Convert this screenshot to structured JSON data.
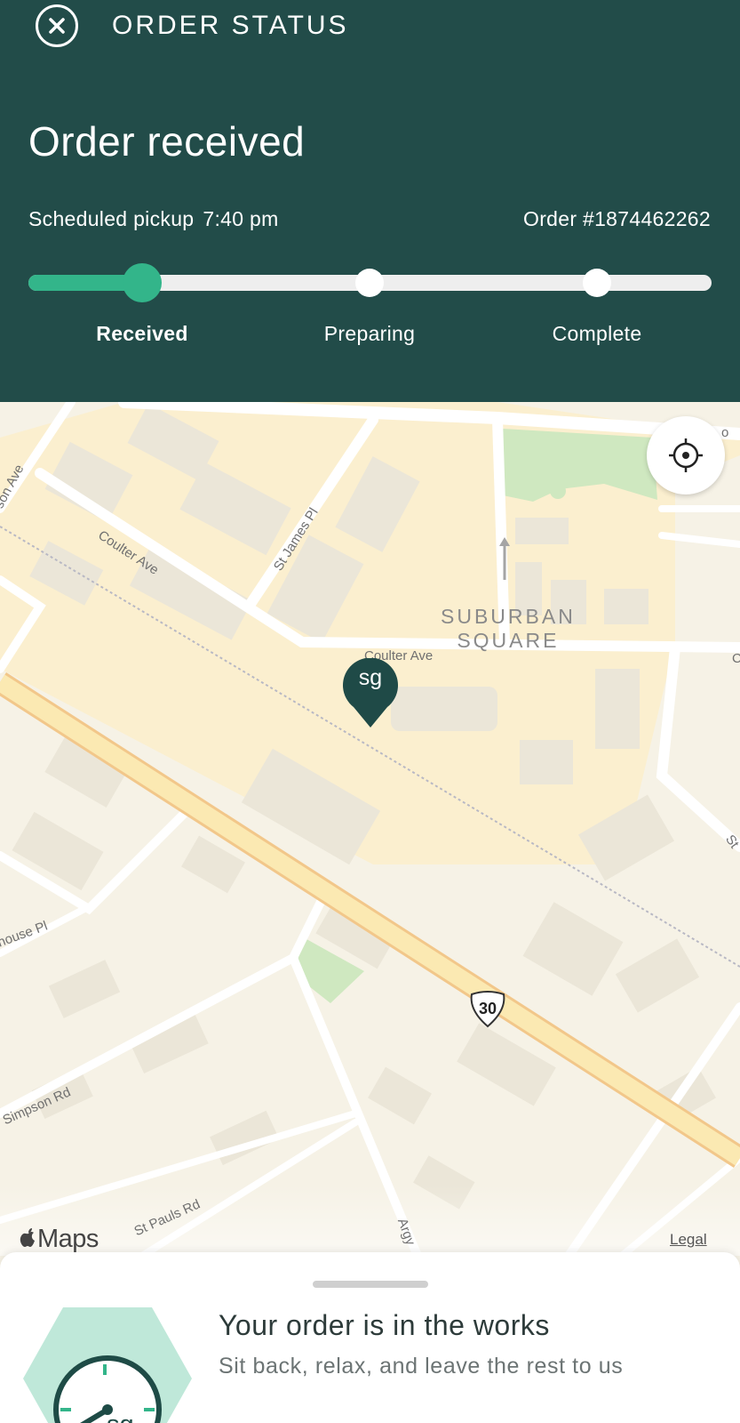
{
  "header": {
    "title": "ORDER STATUS",
    "close_icon": "close-circle-icon",
    "status_heading": "Order received",
    "scheduled_label": "Scheduled pickup",
    "scheduled_time": "7:40 pm",
    "order_number": "Order #1874462262"
  },
  "progress": {
    "current_step": 1,
    "total_steps": 3,
    "steps": [
      {
        "label": "Received",
        "state": "active"
      },
      {
        "label": "Preparing",
        "state": "pending"
      },
      {
        "label": "Complete",
        "state": "pending"
      }
    ],
    "colors": {
      "active": "#33b58a",
      "track": "#eeeeee",
      "header_bg": "#224c49"
    }
  },
  "map": {
    "district": "SUBURBAN\nSQUARE",
    "streets": [
      "son Ave",
      "Coulter Ave",
      "St James Pl",
      "Coulter Ave",
      "house Pl",
      "Simpson Rd",
      "St Pauls Rd",
      "Argy",
      "o",
      "C",
      "St"
    ],
    "route_shield": "30",
    "store_pin_label": "sg",
    "locate_icon": "crosshair-locate-icon",
    "attribution": "Maps",
    "legal": "Legal"
  },
  "sheet": {
    "title": "Your order is in the works",
    "subtitle": "Sit back, relax, and leave the rest to us",
    "badge_label": "sg",
    "badge_icon": "clock-icon"
  }
}
